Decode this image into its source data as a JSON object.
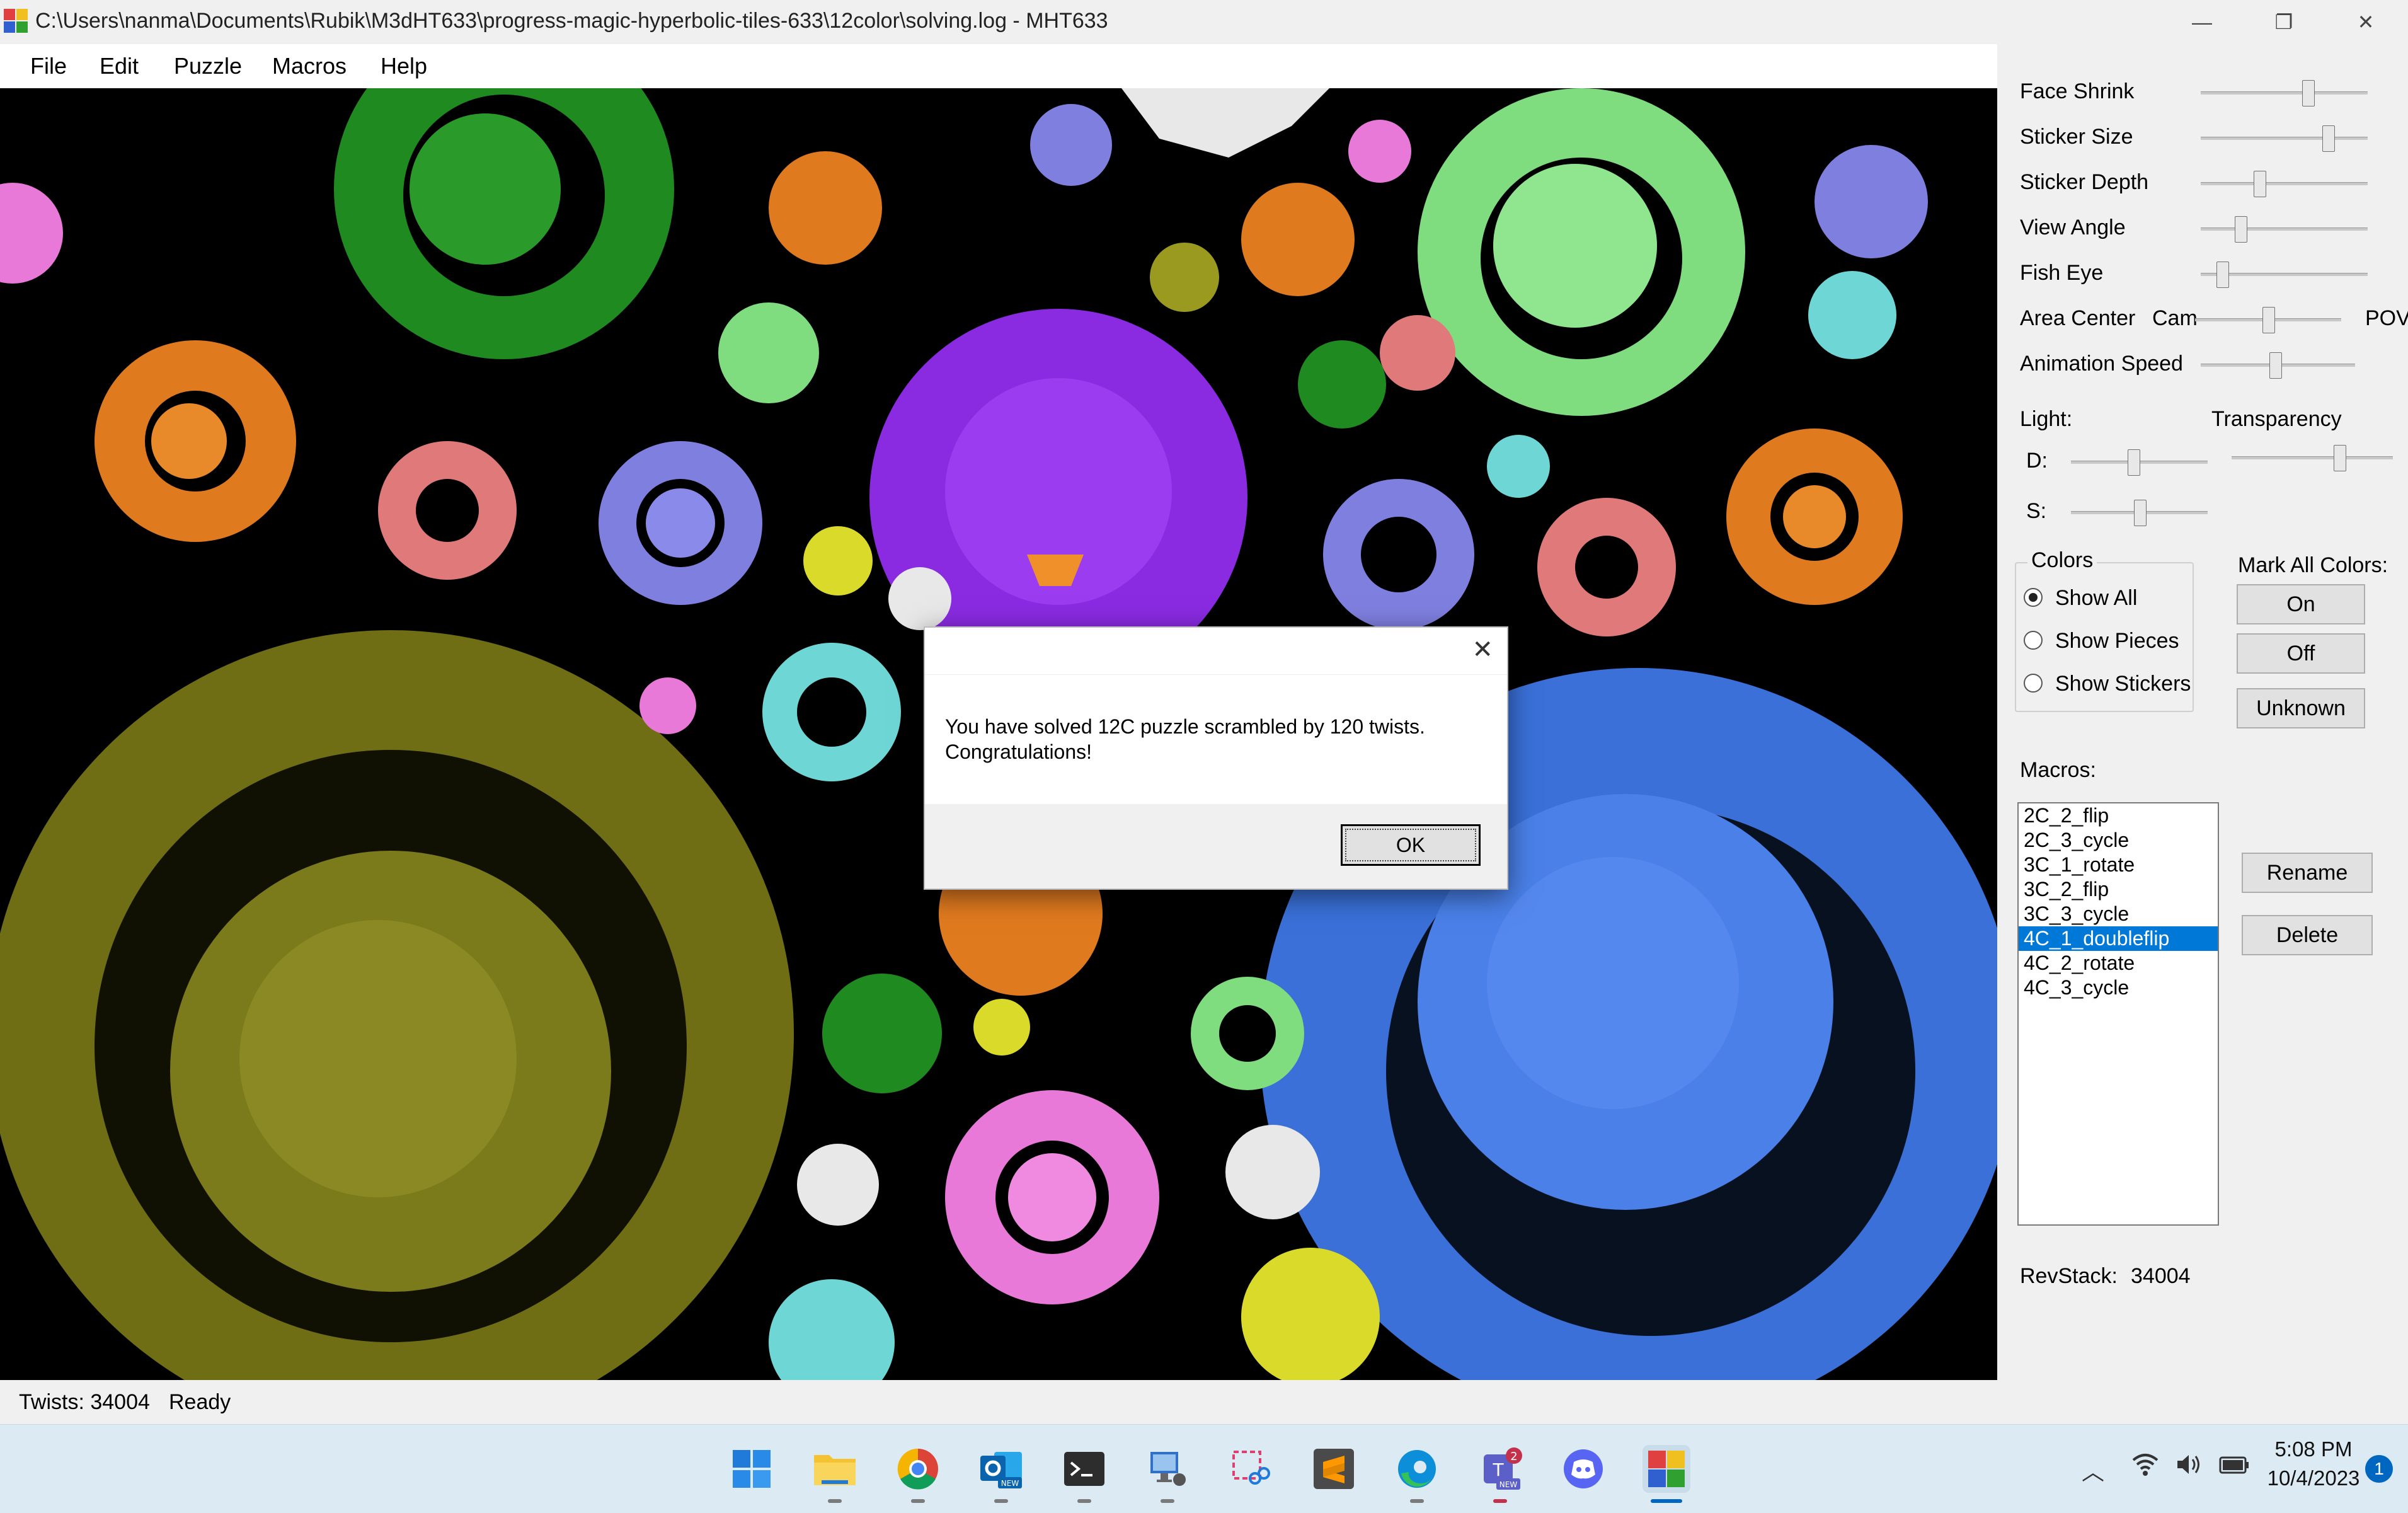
{
  "window": {
    "title": "C:\\Users\\nanma\\Documents\\Rubik\\M3dHT633\\progress-magic-hyperbolic-tiles-633\\12color\\solving.log - MHT633",
    "minimize": "—",
    "maximize": "❐",
    "close": "✕"
  },
  "menu": [
    "File",
    "Edit",
    "Puzzle",
    "Macros",
    "Help"
  ],
  "panel": {
    "sliders": {
      "face_shrink": {
        "label": "Face Shrink",
        "value": 0.65
      },
      "sticker_size": {
        "label": "Sticker Size",
        "value": 0.78
      },
      "sticker_depth": {
        "label": "Sticker Depth",
        "value": 0.34
      },
      "view_angle": {
        "label": "View Angle",
        "value": 0.22
      },
      "fish_eye": {
        "label": "Fish Eye",
        "value": 0.1
      },
      "area_center": {
        "label": "Area Center",
        "left": "Cam",
        "right": "POV",
        "value": 0.5
      },
      "animation_speed": {
        "label": "Animation Speed",
        "value": 0.48
      }
    },
    "light": {
      "label": "Light:",
      "d_label": "D:",
      "s_label": "S:",
      "d_value": 0.45,
      "s_value": 0.5
    },
    "transparency": {
      "label": "Transparency",
      "value": 0.68
    },
    "colors": {
      "title": "Colors",
      "options": [
        "Show All",
        "Show Pieces",
        "Show Stickers"
      ],
      "selected": "Show All"
    },
    "mark_all": {
      "label": "Mark All Colors:",
      "on": "On",
      "off": "Off",
      "unknown": "Unknown"
    },
    "macros": {
      "label": "Macros:",
      "items": [
        "2C_2_flip",
        "2C_3_cycle",
        "3C_1_rotate",
        "3C_2_flip",
        "3C_3_cycle",
        "4C_1_doubleflip",
        "4C_2_rotate",
        "4C_3_cycle"
      ],
      "selected": "4C_1_doubleflip",
      "rename": "Rename",
      "delete": "Delete"
    },
    "revstack": {
      "label": "RevStack:",
      "value": "34004"
    }
  },
  "status": {
    "twists": "Twists: 34004",
    "state": "Ready"
  },
  "dialog": {
    "line1": "You have solved 12C puzzle scrambled by 120 twists.",
    "line2": "Congratulations!",
    "ok": "OK",
    "close": "✕"
  },
  "taskbar": {
    "time": "5:08 PM",
    "date": "10/4/2023",
    "notifications": "1",
    "teams_badge": "2",
    "new_badge": "NEW",
    "apps": [
      "start-icon",
      "file-explorer-icon",
      "chrome-icon",
      "outlook-icon",
      "terminal-icon",
      "remote-desktop-icon",
      "snipping-tool-icon",
      "sublime-text-icon",
      "edge-icon",
      "teams-icon",
      "discord-icon",
      "mht633-icon"
    ]
  },
  "colors": {
    "olive": "#7c7b1c",
    "blue": "#3f78e0",
    "purple": "#8a2be2",
    "green": "#1f8a1f",
    "lightgreen": "#7fdc7f",
    "orange": "#e07a1f",
    "pink": "#e879d8",
    "salmon": "#e07a7a",
    "lavender": "#7f7fe0",
    "cyan": "#6fd6d6",
    "yellow": "#dada2a",
    "white": "#e8e8e8",
    "selection": "#0078d7"
  }
}
